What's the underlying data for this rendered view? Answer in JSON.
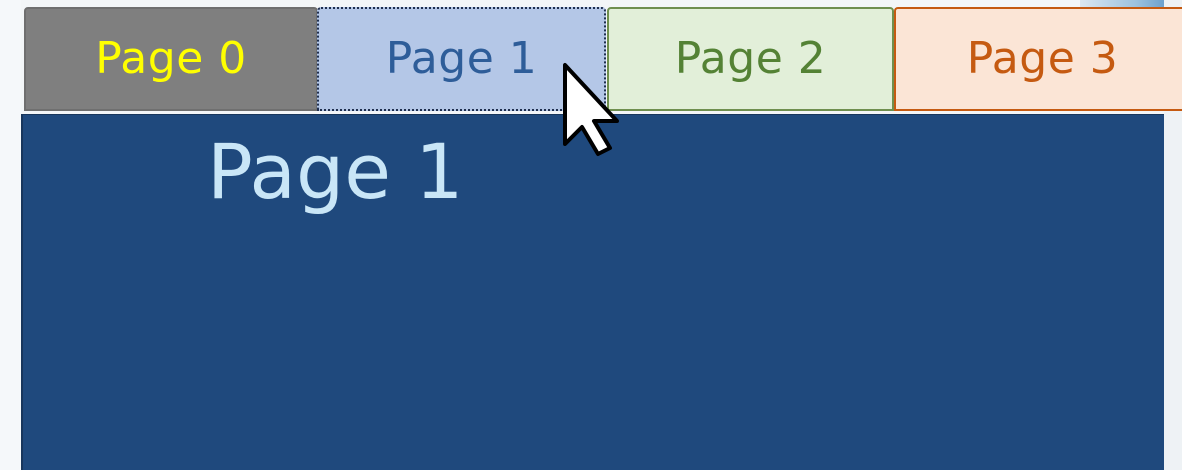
{
  "tabs": [
    {
      "label": "Page 0",
      "selected": false,
      "background": "#7f7f7f",
      "text_color": "#ffff00"
    },
    {
      "label": "Page 1",
      "selected": true,
      "background": "#b4c7e7",
      "text_color": "#2e5d99"
    },
    {
      "label": "Page 2",
      "selected": false,
      "background": "#e2efd9",
      "text_color": "#548235"
    },
    {
      "label": "Page 3",
      "selected": false,
      "background": "#fbe5d6",
      "text_color": "#c55a11"
    }
  ],
  "content": {
    "heading": "Page 1",
    "background": "#1f497d",
    "text_color": "#c9e6f7"
  },
  "cursor": {
    "icon": "arrow-pointer-icon"
  }
}
